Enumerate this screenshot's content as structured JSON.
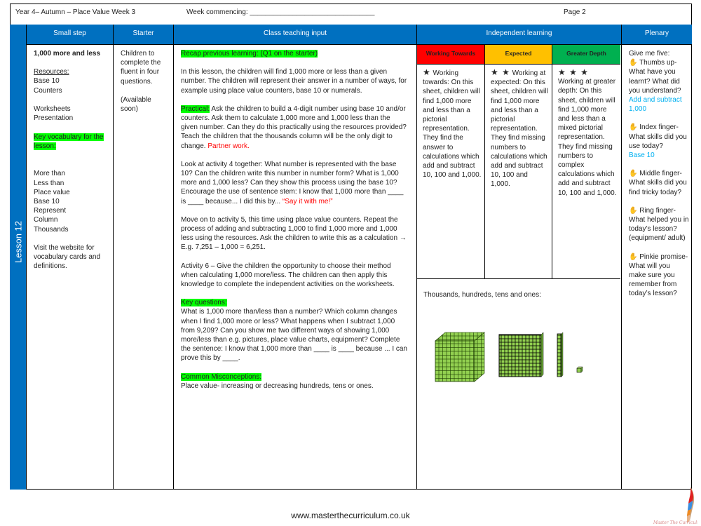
{
  "header": {
    "title": "Year 4– Autumn – Place Value Week 3",
    "week_commencing": "Week commencing: ________________________________",
    "page": "Page 2"
  },
  "lesson_label": "Lesson 12",
  "columns": {
    "small_step": "Small step",
    "starter": "Starter",
    "class_teaching": "Class teaching input",
    "independent": "Independent learning",
    "plenary": "Plenary"
  },
  "small_step": {
    "title": "1,000 more and less",
    "resources_label": "Resources:",
    "resources": [
      "Base 10",
      "Counters"
    ],
    "resources2": [
      "Worksheets",
      "Presentation"
    ],
    "vocab_label": "Key vocabulary for the lesson:",
    "vocab": [
      "More than",
      "Less than",
      "Place value",
      "Base 10",
      "Represent",
      "Column",
      "Thousands"
    ],
    "website_note": "Visit the website for vocabulary cards and definitions."
  },
  "starter": {
    "text": "Children to complete the fluent in four questions.",
    "note": "(Available soon)"
  },
  "class_teaching": {
    "recap": "Recap previous learning: (Q1 on the starter)",
    "intro": "In this lesson, the children will find 1,000 more or less than a given number. The children will represent their answer in a number of ways, for example using place value counters, base 10 or numerals.",
    "practical_label": "Practical:",
    "practical_text": " Ask the children to build a 4-digit number using base 10 and/or counters. Ask them to calculate 1,000 more and 1,000 less than the given number. Can they do this practically using the resources provided? Teach the children that the thousands column will be the only digit to change. ",
    "partner_work": "Partner work.",
    "activity4": "Look at activity 4 together: What number is represented with the base 10? Can the children write this number in number form? What is 1,000 more and 1,000 less? Can they show this process using the base 10? Encourage the use of sentence stem: I know that 1,000 more than ____ is ____ because... I did this by... ",
    "say_it": "“Say it with me!”",
    "activity5": "Move on to activity 5, this time using place value counters. Repeat the process of adding and subtracting 1,000 to find 1,000 more and 1,000 less using the resources. Ask the children to write this as a calculation → E.g. 7,251 – 1,000 = 6,251.",
    "activity6": "Activity 6 – Give the children the opportunity to choose their method when calculating 1,000 more/less. The children can then apply this knowledge to complete the independent activities on the worksheets.",
    "key_questions_label": "Key questions:",
    "key_questions": "What is 1,000 more than/less than a number? Which column changes when I find 1,000 more or less? What happens when I subtract 1,000 from 9,209? Can you show me two different ways of showing 1,000 more/less than e.g. pictures, place value charts, equipment? Complete the sentence: I know that 1,000 more than ____ is ____ because ... I can prove this by ____.",
    "misconceptions_label": "Common Misconceptions:",
    "misconceptions": "Place value- increasing or decreasing hundreds, tens or ones."
  },
  "independent": {
    "levels": [
      {
        "label": "Working Towards",
        "color": "#ff0000",
        "stars": "★",
        "text": "Working towards: On this sheet, children will find 1,000 more and less than a pictorial representation. They find the answer to calculations which add and subtract 10, 100 and 1,000."
      },
      {
        "label": "Expected",
        "color": "#ffc000",
        "stars": "★ ★",
        "text": "Working at expected: On this sheet, children will find 1,000 more and less than a pictorial representation. They find missing numbers to calculations which add and subtract 10, 100 and 1,000."
      },
      {
        "label": "Greater Depth",
        "color": "#00b050",
        "stars": "★ ★ ★",
        "text": "Working at greater depth: On this sheet, children will find 1,000 more and less than a mixed pictorial representation. They find missing numbers to complex calculations which add and subtract 10, 100 and 1,000."
      }
    ],
    "caption": "Thousands, hundreds, tens and ones:",
    "block_images": [
      "thousand-cube",
      "hundred-flat",
      "ten-rod",
      "one-cube"
    ]
  },
  "plenary": {
    "intro": "Give me five:",
    "items": [
      {
        "icon": "✋",
        "finger": "Thumbs up-",
        "question": "What have you learnt? What did you understand?",
        "answer": "Add and subtract 1,000"
      },
      {
        "icon": "✋",
        "finger": "Index finger-",
        "question": "What skills did you use today?",
        "answer": "Base 10"
      },
      {
        "icon": "✋",
        "finger": "Middle finger-",
        "question": "What skills did you find tricky today?",
        "answer": ""
      },
      {
        "icon": "✋",
        "finger": "Ring finger-",
        "question": "What helped you in today’s lesson? (equipment/ adult)",
        "answer": ""
      },
      {
        "icon": "✋",
        "finger": "Pinkie",
        "question": "promise- What will you make sure you remember from today’s lesson?",
        "answer": ""
      }
    ]
  },
  "footer": {
    "url": "www.masterthecurriculum.co.uk",
    "logo_text": "Master The Curriculum"
  },
  "colors": {
    "header_blue": "#0070c0",
    "highlight": "#00ff00",
    "accent_red": "#ff0000",
    "accent_blue": "#00b0f0",
    "block_green": "#92d050"
  }
}
